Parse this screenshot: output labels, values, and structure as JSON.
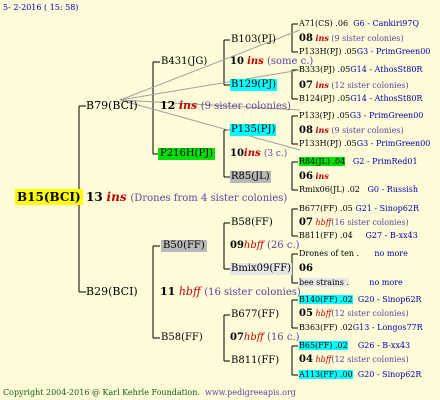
{
  "header": {
    "date": "5- 2-2016 ( 15: 58)"
  },
  "footer": {
    "copyright": "Copyright 2004-2016 @ Karl Kehrle Foundation.",
    "url": "www.pedigreeapis.org"
  },
  "tree": {
    "root": {
      "name": "B15(BCI)",
      "num": "13",
      "ins": "ins",
      "note": "(Drones from 4 sister colonies)"
    },
    "g1_top": {
      "name": "B79(BCI)",
      "num": "12",
      "ins": "ins",
      "note": "(9 sister colonies)"
    },
    "g1_bot": {
      "name": "B29(BCI)",
      "num": "11",
      "ins": "hbff",
      "note": "(16 sister colonies)"
    },
    "g2": [
      {
        "name": "B431(JG)",
        "num": "10",
        "ins": "ins",
        "note": "(some c.)"
      },
      {
        "name": "P216H(PJ)",
        "num": "10",
        "ins": "ins",
        "note": "(3 c.)"
      },
      {
        "name": "B50(FF)",
        "num": "09",
        "ins": "hbff",
        "note": "(26 c.)"
      },
      {
        "name": "B58(FF)",
        "num": "07",
        "ins": "hbff",
        "note": "(16 c.)"
      }
    ],
    "g3": [
      {
        "name": "B103(PJ)"
      },
      {
        "name": "B129(PJ)"
      },
      {
        "name": "P135(PJ)"
      },
      {
        "name": "R85(JL)"
      },
      {
        "name": "B58(FF)"
      },
      {
        "name": "Bmix09(FF)"
      },
      {
        "name": "B677(FF)"
      },
      {
        "name": "B811(FF)"
      }
    ],
    "g4": [
      {
        "text": "A71(CS) .06",
        "extra": "G6 - Cankiri97Q"
      },
      {
        "num": "08",
        "ins": "ins",
        "note": "(9 sister colonies)"
      },
      {
        "text": "P133H(PJ) .05",
        "extra": "G3 - PrimGreen00"
      },
      {
        "text": "B333(PJ) .05",
        "extra": "G14 - AthosSt80R"
      },
      {
        "num": "07",
        "ins": "ins",
        "note": "(12 sister colonies)"
      },
      {
        "text": "B124(PJ) .05",
        "extra": "G14 - AthosSt80R"
      },
      {
        "text": "P133(PJ) .05",
        "extra": "G3 - PrimGreen00"
      },
      {
        "num": "08",
        "ins": "ins",
        "note": "(9 sister colonies)"
      },
      {
        "text": "P133H(PJ) .05",
        "extra": "G3 - PrimGreen00"
      },
      {
        "text": "R84(JL) .04",
        "extra": "G2 - PrimRed01"
      },
      {
        "num": "06",
        "ins": "ins"
      },
      {
        "text": "Rmix06(JL) .02",
        "extra": "G0 - Russish"
      },
      {
        "text": "B677(FF) .05",
        "extra": "G21 - Sinop62R"
      },
      {
        "num": "07",
        "ins": "hbff",
        "note": "(16 sister colonies)"
      },
      {
        "text": "B811(FF) .04",
        "extra": "G27 - B-xx43"
      },
      {
        "text": "Drones of ten .",
        "extra": "no more"
      },
      {
        "num": "06"
      },
      {
        "text": "bee strains .",
        "extra": "no more"
      },
      {
        "text": "B140(FF) .02",
        "extra": "G20 - Sinop62R"
      },
      {
        "num": "05",
        "ins": "hbff",
        "note": "(12 sister colonies)"
      },
      {
        "text": "B363(FF) .02",
        "extra": "G13 - Longos77R"
      },
      {
        "text": "B65(FF) .02",
        "extra": "G26 - B-xx43"
      },
      {
        "num": "04",
        "ins": "hbff",
        "note": "(12 sister colonies)"
      },
      {
        "text": "A113(FF) .00",
        "extra": "G20 - Sinop62R"
      }
    ]
  }
}
